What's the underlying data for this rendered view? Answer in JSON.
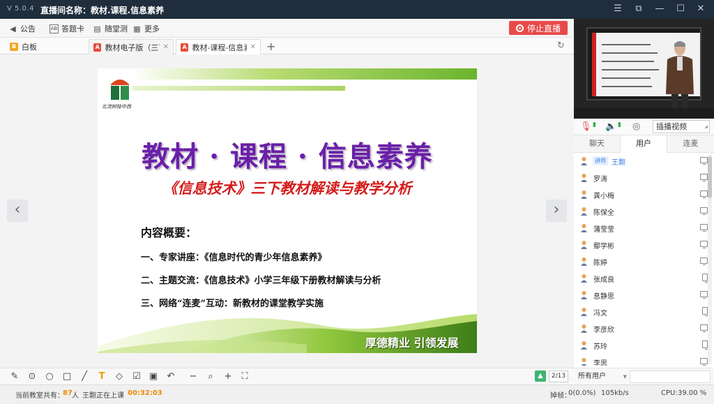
{
  "app": {
    "version": "V 5.0.4",
    "title": "直播间名称：教材.课程.信息素养",
    "window_controls": [
      "menu-icon",
      "restore-icon",
      "minimize-icon",
      "maximize-icon",
      "close-icon"
    ]
  },
  "toolbar": {
    "announcement": "公告",
    "answer_card": "答题卡",
    "quiz": "随堂测",
    "more": "更多",
    "stop_live": "停止直播",
    "stop_color": "#e84a4a"
  },
  "tabs": [
    {
      "label": "白板",
      "icon": "whiteboard-icon"
    },
    {
      "label": "教材电子版（三下",
      "icon": "pdf-icon"
    },
    {
      "label": "教材-课程-信息素养",
      "icon": "pdf-icon"
    }
  ],
  "slide": {
    "main_title": "教材 · 课程 · 信息素养",
    "subtitle": "《信息技术》三下教材解读与教学分析",
    "overview_heading": "内容概要：",
    "items": [
      "一、专家讲座：《信息时代的青少年信息素养》",
      "二、主题交流：《信息技术》小学三年级下册教材解读与分析",
      "三、网络“连麦”互动：新教材的课堂教学实施"
    ],
    "motto": "厚德精业 引领发展",
    "logo_text": "北流树桂中西"
  },
  "pager": {
    "page": "2/13"
  },
  "status": {
    "online_label": "当前教室共有：",
    "online_count": "87",
    "online_unit": "人",
    "teacher_status": "王翾正在上课",
    "elapsed": "00:32:03",
    "lag_label": "掉帧：",
    "lag_value": "0(0.0%)",
    "bitrate": "105kb/s",
    "cpu_label": "CPU:",
    "cpu_value": "39.00 %"
  },
  "av": {
    "video_source": "插播视频"
  },
  "right_tabs": [
    "聊天",
    "用户",
    "连麦"
  ],
  "users": [
    {
      "name": "王翾",
      "badge": "讲师",
      "device": "pc"
    },
    {
      "name": "罗涛",
      "badge": "",
      "device": "pc"
    },
    {
      "name": "龚小梅",
      "badge": "",
      "device": "pc"
    },
    {
      "name": "陈保全",
      "badge": "",
      "device": "pc"
    },
    {
      "name": "蒲莹莹",
      "badge": "",
      "device": "pc"
    },
    {
      "name": "鄢学彬",
      "badge": "",
      "device": "pc"
    },
    {
      "name": "陈婷",
      "badge": "",
      "device": "pc"
    },
    {
      "name": "张成良",
      "badge": "",
      "device": "tablet"
    },
    {
      "name": "息静思",
      "badge": "",
      "device": "pc"
    },
    {
      "name": "冯文",
      "badge": "",
      "device": "tablet"
    },
    {
      "name": "李彦欣",
      "badge": "",
      "device": "pc"
    },
    {
      "name": "苏玲",
      "badge": "",
      "device": "tablet"
    },
    {
      "name": "李思",
      "badge": "",
      "device": "pc"
    }
  ],
  "user_filter": "所有用户"
}
